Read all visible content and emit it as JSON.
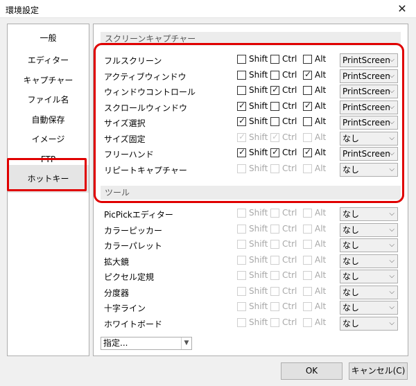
{
  "window": {
    "title": "環境設定",
    "close": "✕"
  },
  "sidebar": {
    "items": [
      {
        "label": "一般"
      },
      {
        "label": "エディター"
      },
      {
        "label": "キャプチャー"
      },
      {
        "label": "ファイル名"
      },
      {
        "label": "自動保存"
      },
      {
        "label": "イメージ"
      },
      {
        "label": "FTP"
      },
      {
        "label": "ホットキー",
        "active": true
      }
    ]
  },
  "capture": {
    "header": "スクリーンキャプチャー",
    "rows": [
      {
        "label": "フルスクリーン",
        "shift": false,
        "ctrl": false,
        "alt": false,
        "disabled": false,
        "key": "PrintScreen"
      },
      {
        "label": "アクティブウィンドウ",
        "shift": false,
        "ctrl": false,
        "alt": true,
        "disabled": false,
        "key": "PrintScreen"
      },
      {
        "label": "ウィンドウコントロール",
        "shift": false,
        "ctrl": true,
        "alt": false,
        "disabled": false,
        "key": "PrintScreen"
      },
      {
        "label": "スクロールウィンドウ",
        "shift": true,
        "ctrl": false,
        "alt": true,
        "disabled": false,
        "key": "PrintScreen"
      },
      {
        "label": "サイズ選択",
        "shift": true,
        "ctrl": false,
        "alt": false,
        "disabled": false,
        "key": "PrintScreen"
      },
      {
        "label": "サイズ固定",
        "shift": true,
        "ctrl": true,
        "alt": false,
        "disabled": true,
        "key": "なし"
      },
      {
        "label": "フリーハンド",
        "shift": true,
        "ctrl": true,
        "alt": true,
        "disabled": false,
        "key": "PrintScreen"
      },
      {
        "label": "リピートキャプチャー",
        "shift": false,
        "ctrl": false,
        "alt": false,
        "disabled": true,
        "key": "なし"
      }
    ]
  },
  "tools": {
    "header": "ツール",
    "rows": [
      {
        "label": "PicPickエディター",
        "shift": false,
        "ctrl": false,
        "alt": false,
        "disabled": true,
        "key": "なし"
      },
      {
        "label": "カラーピッカー",
        "shift": false,
        "ctrl": false,
        "alt": false,
        "disabled": true,
        "key": "なし"
      },
      {
        "label": "カラーパレット",
        "shift": false,
        "ctrl": false,
        "alt": false,
        "disabled": true,
        "key": "なし"
      },
      {
        "label": "拡大鏡",
        "shift": false,
        "ctrl": false,
        "alt": false,
        "disabled": true,
        "key": "なし"
      },
      {
        "label": "ピクセル定規",
        "shift": false,
        "ctrl": false,
        "alt": false,
        "disabled": true,
        "key": "なし"
      },
      {
        "label": "分度器",
        "shift": false,
        "ctrl": false,
        "alt": false,
        "disabled": true,
        "key": "なし"
      },
      {
        "label": "十字ライン",
        "shift": false,
        "ctrl": false,
        "alt": false,
        "disabled": true,
        "key": "なし"
      },
      {
        "label": "ホワイトボード",
        "shift": false,
        "ctrl": false,
        "alt": false,
        "disabled": true,
        "key": "なし"
      }
    ]
  },
  "modifiers": {
    "shift": "Shift",
    "ctrl": "Ctrl",
    "alt": "Alt",
    "check": "✓",
    "arrow": "⌵"
  },
  "preset": {
    "value": "指定...",
    "arrow": "▼"
  },
  "buttons": {
    "ok": "OK",
    "cancel": "キャンセル(C)"
  },
  "colors": {
    "highlight": "#e00000"
  }
}
